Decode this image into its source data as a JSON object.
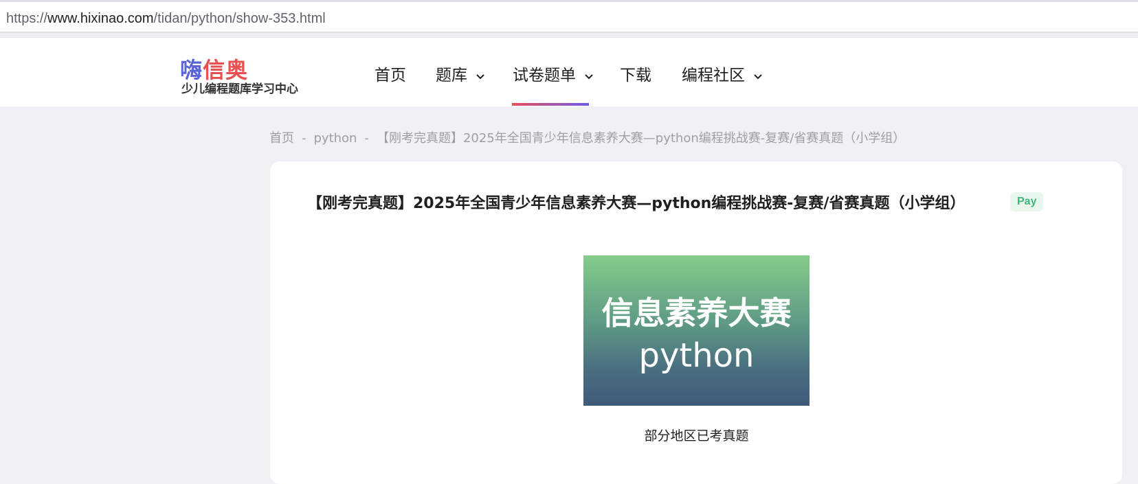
{
  "browser": {
    "url_scheme": "https://",
    "url_host": "www.hixinao.com",
    "url_path": "/tidan/python/show-353.html"
  },
  "logo": {
    "main_1": "嗨",
    "main_2": "信",
    "main_3": "奥",
    "subtitle": "少儿编程题库学习中心"
  },
  "nav": {
    "items": [
      {
        "label": "首页"
      },
      {
        "label": "题库"
      },
      {
        "label": "试卷题单"
      },
      {
        "label": "下载"
      },
      {
        "label": "编程社区"
      }
    ],
    "active": "试卷题单",
    "accent_start": "#ea4f5e",
    "accent_end": "#6c5ce7"
  },
  "breadcrumb": {
    "home": "首页",
    "category": "python",
    "current": "【刚考完真题】2025年全国青少年信息素养大赛—python编程挑战赛-复赛/省赛真题（小学组）",
    "separator": "-"
  },
  "article": {
    "title": "【刚考完真题】2025年全国青少年信息素养大赛—python编程挑战赛-复赛/省赛真题（小学组）",
    "badge": "Pay",
    "cover_line1": "信息素养大赛",
    "cover_line2": "python",
    "caption": "部分地区已考真题"
  }
}
